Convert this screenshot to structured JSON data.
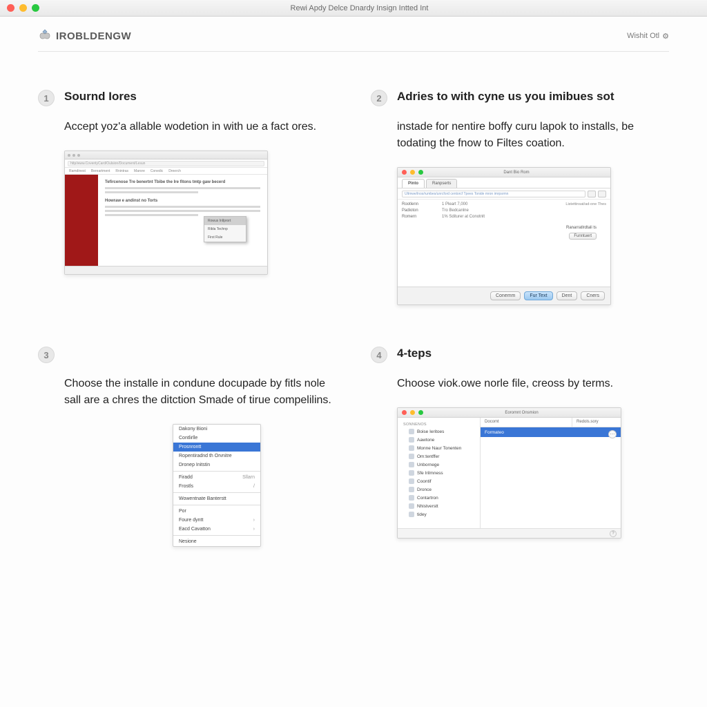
{
  "window": {
    "title": "Rewi Apdy Delce Dnardy Insign Intted Int"
  },
  "brand": {
    "name": "IROBLDENGW"
  },
  "toplink": {
    "label": "Wishit Otl"
  },
  "steps": [
    {
      "num": "1",
      "title": "Sournd Iores",
      "desc": "Accept yoz'a allable wodetion in with ue a fact ores.",
      "shot": {
        "url": "http/www.CoventyCard/Oulsion/Document/Lesun",
        "tabs": [
          "Ramdinest",
          "Bereartment",
          "Rnintras",
          "Marore",
          "Conedic",
          "Dreerch"
        ],
        "menu": [
          "Rowus Inllprort",
          "Ribla Technp",
          "First Rule"
        ]
      }
    },
    {
      "num": "2",
      "title": "Adries to with cyne us you imibues sot",
      "desc": "instade for nentire boffy curu lapok to installs, be todating the fnow to Filtes coation.",
      "shot": {
        "title": "Dant Bio Rom",
        "tabs": [
          "Pinto",
          "Ranpserts"
        ],
        "field": "Ultmwe/lnos/rumbes/unrcford centorcf Tpees Tonide mron imrpsrmn",
        "rows": [
          {
            "k": "Rootlenn",
            "v": "1 Pleart 7,000"
          },
          {
            "k": "Padioton",
            "v": "Tro Bedcanlne"
          },
          {
            "k": "Romern",
            "v": "1% Sditurer at Conotnlt"
          }
        ],
        "right_col_header": "Listettinsat/ad-one Thes",
        "right_label": "Ranarratlrdtali ts",
        "right_btn": "Funntuert",
        "buttons": [
          "Conemm",
          "Fur Text",
          "Dent",
          "Cners"
        ]
      }
    },
    {
      "num": "3",
      "title": "",
      "desc": "Choose the installe in condune docupade by fitls nole sall are a chres the ditction Smade of tirue compelilins.",
      "shot": {
        "items": [
          {
            "label": "Dakony Bioni",
            "sub": ""
          },
          {
            "label": "Contlirlle"
          },
          {
            "label": "Prosnrontt",
            "hl": true
          },
          {
            "label": "Ropentiradnd th Orvnitre"
          },
          {
            "label": "Dronep Initstin"
          },
          {
            "label": "Firadd",
            "sub": "Sllarn"
          },
          {
            "label": "Frostls",
            "sub": "/"
          },
          {
            "label": "Wowentnate Banterstt"
          },
          {
            "label": "Por"
          },
          {
            "label": "Foure dyntt",
            "sub": "›"
          },
          {
            "label": "Eacd Cavatton",
            "sub": "›"
          },
          {
            "label": "Nesione"
          }
        ]
      }
    },
    {
      "num": "4",
      "title": "4-teps",
      "desc": "Choose viok.owe norle file, creoss by terms.",
      "shot": {
        "title": "Eoromnt Onsmion",
        "section": "Sonnenos",
        "sidebar": [
          "Boise Ieritoes",
          "Aawtone",
          "Monne Naur Tonenten",
          "Om:tentffer",
          "Unbornege",
          "Sfe Irilmness",
          "Coontif",
          "Dronce",
          "Contartron",
          "Nhistverstt",
          "tidey"
        ],
        "cols": [
          "Docomt",
          "Redols.sory"
        ],
        "selected": "Formateo"
      }
    }
  ]
}
